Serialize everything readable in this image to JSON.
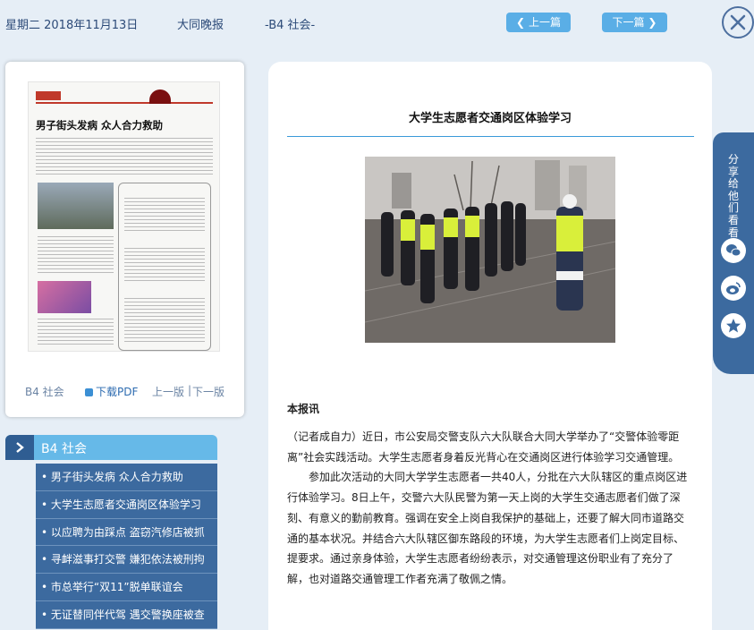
{
  "header": {
    "date": "星期二 2018年11月13日",
    "paper_name": "大同晚报",
    "page_label": "-B4 社会-",
    "prev_label": "上一篇",
    "next_label": "下一篇"
  },
  "thumbnail": {
    "headline": "男子街头发病 众人合力救助",
    "footer_section": "B4 社会",
    "download_pdf": "下载PDF",
    "prev_page": "上一版",
    "separator": "|",
    "next_page": "下一版"
  },
  "section": {
    "title": "B4 社会",
    "articles": [
      "• 男子街头发病 众人合力救助",
      "• 大学生志愿者交通岗区体验学习",
      "• 以应聘为由踩点 盗窃汽修店被抓",
      "• 寻衅滋事打交警 嫌犯依法被刑拘",
      "• 市总举行“双11”脱单联谊会",
      "• 无证替同伴代驾 遇交警换座被查"
    ]
  },
  "article": {
    "title": "大学生志愿者交通岗区体验学习",
    "byline": "本报讯",
    "paragraphs": [
      "（记者成自力）近日，市公安局交警支队六大队联合大同大学举办了“交警体验零距离”社会实践活动。大学生志愿者身着反光背心在交通岗区进行体验学习交通管理。",
      "参加此次活动的大同大学学生志愿者一共40人，分批在六大队辖区的重点岗区进行体验学习。8日上午，交警六大队民警为第一天上岗的大学生交通志愿者们做了深刻、有意义的勤前教育。强调在安全上岗自我保护的基础上，还要了解大同市道路交通的基本状况。并结合六大队辖区御东路段的环境，为大学生志愿者们上岗定目标、提要求。通过亲身体验，大学生志愿者纷纷表示，对交通管理这份职业有了充分了解，也对道路交通管理工作者充满了敬佩之情。"
    ]
  },
  "share": {
    "label": "分享给他们看看",
    "icons": [
      "wechat-icon",
      "weibo-icon",
      "favorite-star-icon"
    ]
  },
  "colors": {
    "accent_blue": "#5aaee6",
    "nav_dark_blue": "#3c6a9f",
    "page_bg": "#e6eef6"
  }
}
